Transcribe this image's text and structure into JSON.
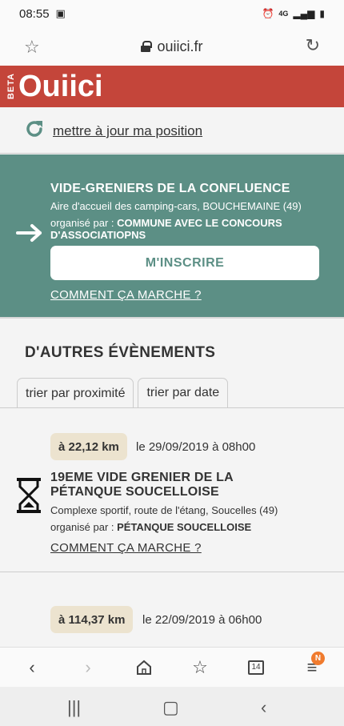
{
  "status": {
    "time": "08:55",
    "network": "4G"
  },
  "browser": {
    "url": "ouiici.fr"
  },
  "header": {
    "beta": "BETA",
    "logo": "Ouiici"
  },
  "update_link": "mettre à jour ma position",
  "featured": {
    "title": "VIDE-GRENIERS DE LA CONFLUENCE",
    "place": "Aire d'accueil des camping-cars, BOUCHEMAINE (49)",
    "org_prefix": "organisé par : ",
    "org_name": "COMMUNE AVEC LE CONCOURS D'ASSOCIATIOPNS",
    "button": "M'INSCRIRE",
    "how": "COMMENT ÇA MARCHE ?"
  },
  "others": {
    "title": "D'AUTRES ÉVÈNEMENTS",
    "tabs": [
      {
        "label": "trier par proximité"
      },
      {
        "label": "trier par date"
      }
    ]
  },
  "events": [
    {
      "distance": "à 22,12 km",
      "date": "le 29/09/2019 à 08h00",
      "title": "19EME VIDE GRENIER DE LA PÉTANQUE SOUCELLOISE",
      "place": "Complexe sportif, route de l'étang, Soucelles (49)",
      "org_prefix": "organisé par : ",
      "org_name": "PÉTANQUE SOUCELLOISE",
      "how": "COMMENT ÇA MARCHE ?"
    },
    {
      "distance": "à 114,37 km",
      "date": "le 22/09/2019 à 06h00"
    }
  ],
  "bottombar": {
    "tabs_count": "14",
    "notif": "N"
  },
  "colors": {
    "brand_red": "#c4453a",
    "teal": "#5c8f85",
    "badge": "#ece3cf",
    "notif": "#f07b2e"
  }
}
